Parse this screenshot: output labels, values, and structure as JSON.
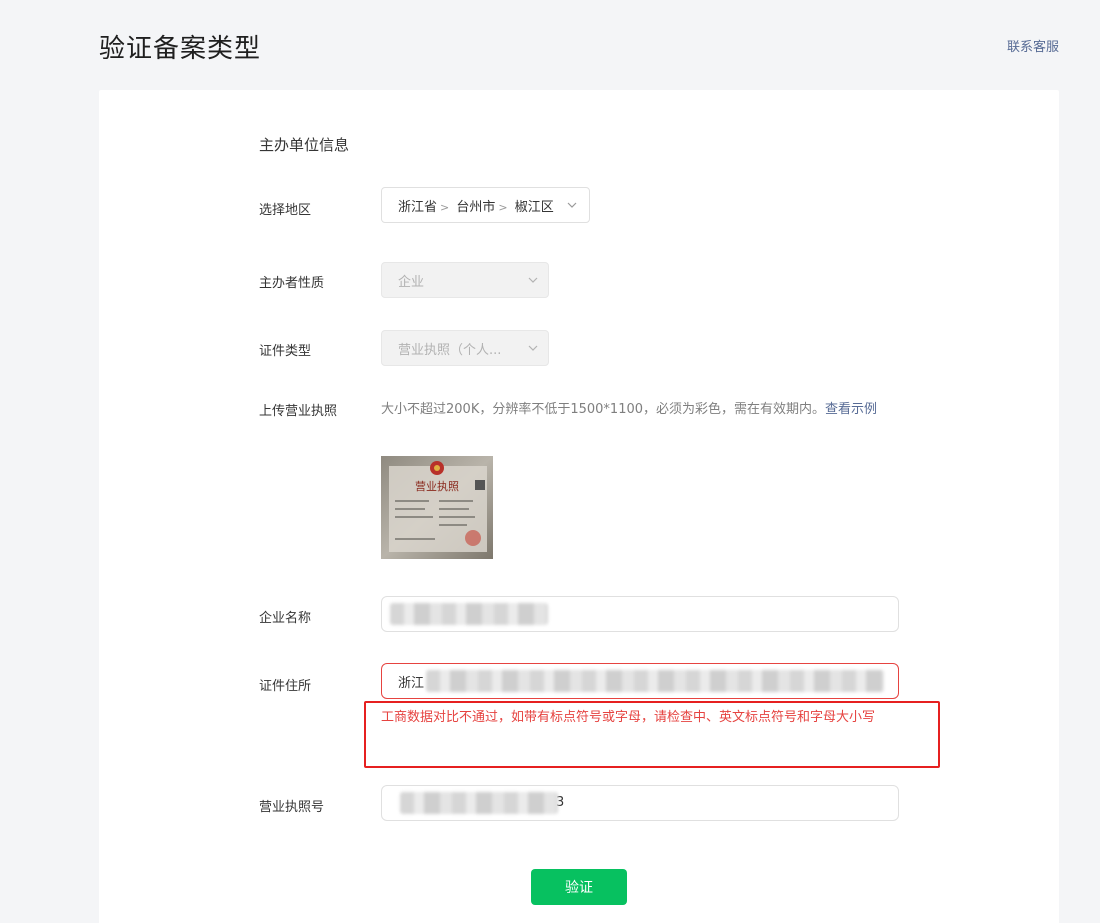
{
  "header": {
    "title": "验证备案类型",
    "contact_link": "联系客服"
  },
  "form": {
    "section_title": "主办单位信息",
    "region": {
      "label": "选择地区",
      "province": "浙江省",
      "city": "台州市",
      "district": "椒江区"
    },
    "organizer_type": {
      "label": "主办者性质",
      "value": "企业"
    },
    "certificate_type": {
      "label": "证件类型",
      "value": "营业执照（个人..."
    },
    "upload": {
      "label": "上传营业执照",
      "hint": "大小不超过200K，分辨率不低于1500*1100，必须为彩色，需在有效期内。",
      "example_link": "查看示例",
      "thumbnail_title": "营业执照"
    },
    "company_name": {
      "label": "企业名称",
      "value": ""
    },
    "certificate_address": {
      "label": "证件住所",
      "value": "浙江"
    },
    "error_message": "工商数据对比不通过，如带有标点符号或字母，请检查中、英文标点符号和字母大小写",
    "license_number": {
      "label": "营业执照号",
      "value": "3"
    },
    "verify_button": "验证"
  },
  "colors": {
    "primary": "#07c160",
    "link": "#576b95",
    "error": "#e64340",
    "annotation": "#e62020"
  }
}
